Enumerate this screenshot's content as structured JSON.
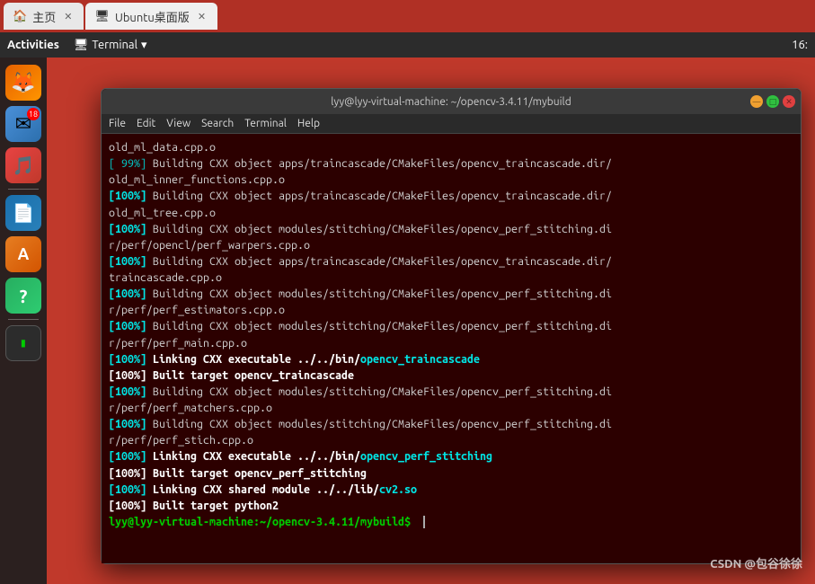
{
  "browser": {
    "tabs": [
      {
        "id": "home",
        "label": "主页",
        "icon": "🏠",
        "active": false
      },
      {
        "id": "ubuntu",
        "label": "Ubuntu桌面版",
        "icon": "🖥",
        "active": true
      }
    ]
  },
  "gnome": {
    "activities": "Activities",
    "app_label": "Terminal",
    "time": "16:"
  },
  "dock": {
    "items": [
      {
        "id": "firefox",
        "class": "firefox",
        "icon": "🦊",
        "label": "Firefox"
      },
      {
        "id": "mail",
        "class": "mail",
        "icon": "✉",
        "label": "Mail"
      },
      {
        "id": "music",
        "class": "music",
        "icon": "🎵",
        "label": "Music"
      },
      {
        "id": "libreoffice",
        "class": "libreoffice",
        "icon": "📄",
        "label": "LibreOffice"
      },
      {
        "id": "store",
        "class": "store",
        "icon": "🅐",
        "label": "App Store"
      },
      {
        "id": "help",
        "class": "help",
        "icon": "?",
        "label": "Help"
      },
      {
        "id": "terminal",
        "class": "terminal",
        "icon": "▮",
        "label": "Terminal"
      }
    ],
    "badge_value": "18"
  },
  "terminal": {
    "title": "lyy@lyy-virtual-machine: ~/opencv-3.4.11/mybuild",
    "menu_items": [
      "File",
      "Edit",
      "View",
      "Search",
      "Terminal",
      "Help"
    ],
    "lines": [
      {
        "type": "normal",
        "text": "old_ml_data.cpp.o"
      },
      {
        "type": "progress",
        "percent": "[ 99%]",
        "rest": " Building CXX object apps/traincascade/CMakeFiles/opencv_traincascade.dir/\nold_ml_inner_functions.cpp.o"
      },
      {
        "type": "progress",
        "percent": "[100%]",
        "rest": " Building CXX object apps/traincascade/CMakeFiles/opencv_traincascade.dir/\nold_ml_tree.cpp.o"
      },
      {
        "type": "progress",
        "percent": "[100%]",
        "rest": " Building CXX object modules/stitching/CMakeFiles/opencv_perf_stitching.di\nr/perf/opencl/perf_warpers.cpp.o"
      },
      {
        "type": "progress",
        "percent": "[100%]",
        "rest": " Building CXX object apps/traincascade/CMakeFiles/opencv_traincascade.dir/\ntraincascade.cpp.o"
      },
      {
        "type": "progress",
        "percent": "[100%]",
        "rest": " Building CXX object modules/stitching/CMakeFiles/opencv_perf_stitching.di\nr/perf/perf_estimators.cpp.o"
      },
      {
        "type": "progress",
        "percent": "[100%]",
        "rest": " Building CXX object modules/stitching/CMakeFiles/opencv_perf_stitching.di\nr/perf/perf_main.cpp.o"
      },
      {
        "type": "link",
        "prefix": "[100%] ",
        "link": "Linking CXX executable ../../bin/opencv_traincascade",
        "after": ""
      },
      {
        "type": "normal_bold",
        "text": "[100%] Built target opencv_traincascade"
      },
      {
        "type": "progress",
        "percent": "[100%]",
        "rest": " Building CXX object modules/stitching/CMakeFiles/opencv_perf_stitching.di\nr/perf/perf_matchers.cpp.o"
      },
      {
        "type": "progress",
        "percent": "[100%]",
        "rest": " Building CXX object modules/stitching/CMakeFiles/opencv_perf_stitching.di\nr/perf/perf_stich.cpp.o"
      },
      {
        "type": "link",
        "prefix": "[100%] ",
        "link": "Linking CXX executable ../../bin/opencv_perf_stitching",
        "after": ""
      },
      {
        "type": "normal_bold",
        "text": "[100%] Built target opencv_perf_stitching"
      },
      {
        "type": "link",
        "prefix": "[100%] ",
        "link": "Linking CXX shared module ../../lib/cv2.so",
        "after": ""
      },
      {
        "type": "normal_bold",
        "text": "[100%] Built target python2"
      },
      {
        "type": "prompt",
        "text": "lyy@lyy-virtual-machine:~/opencv-3.4.11/mybuild$ "
      }
    ]
  },
  "watermark": {
    "text": "CSDN @包谷徐徐"
  }
}
